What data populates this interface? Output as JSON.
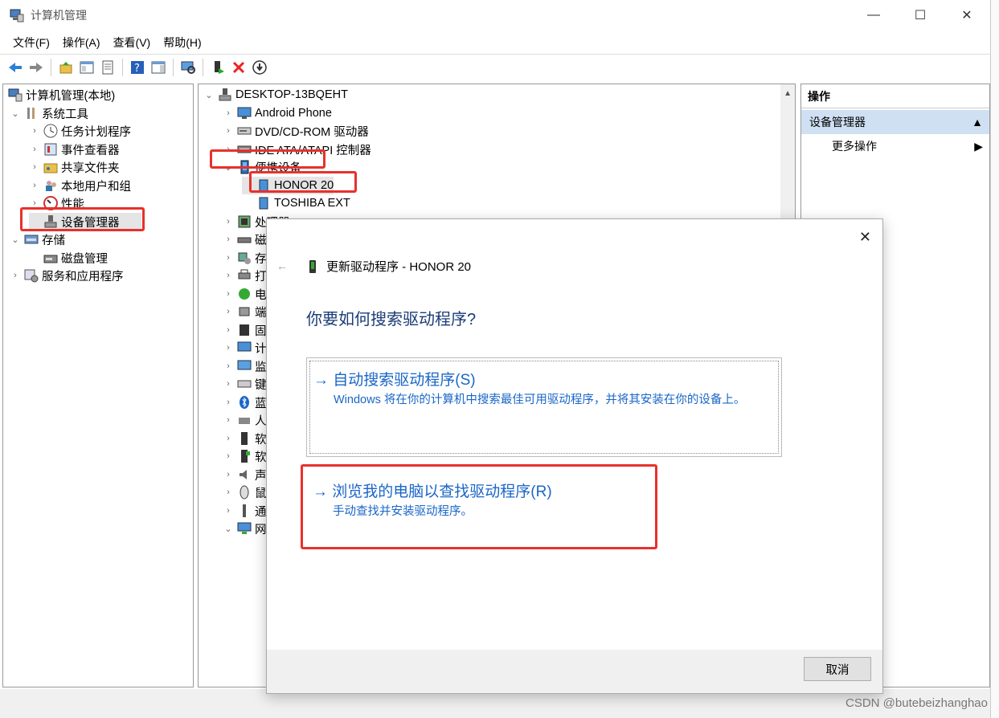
{
  "window": {
    "title": "计算机管理",
    "minimize": "—",
    "maximize": "☐",
    "close": "✕"
  },
  "menu": [
    "文件(F)",
    "操作(A)",
    "查看(V)",
    "帮助(H)"
  ],
  "left_tree": {
    "root": "计算机管理(本地)",
    "system_tools": "系统工具",
    "task_scheduler": "任务计划程序",
    "event_viewer": "事件查看器",
    "shared_folders": "共享文件夹",
    "local_users": "本地用户和组",
    "performance": "性能",
    "device_manager": "设备管理器",
    "storage": "存储",
    "disk_management": "磁盘管理",
    "services_apps": "服务和应用程序"
  },
  "device_tree": {
    "computer": "DESKTOP-13BQEHT",
    "android_phone": "Android Phone",
    "dvd": "DVD/CD-ROM 驱动器",
    "ide": "IDE ATA/ATAPI 控制器",
    "portable": "便携设备",
    "honor": "HONOR 20",
    "toshiba": "TOSHIBA EXT",
    "processor": "处理器",
    "partial": [
      "磁",
      "存",
      "打",
      "电",
      "端",
      "固",
      "计",
      "监",
      "键",
      "蓝",
      "人",
      "软",
      "软",
      "声",
      "鼠",
      "通",
      "网"
    ]
  },
  "ops": {
    "header": "操作",
    "group": "设备管理器",
    "more": "更多操作"
  },
  "dialog": {
    "title": "更新驱动程序 - HONOR 20",
    "heading": "你要如何搜索驱动程序?",
    "option1_title": "自动搜索驱动程序(S)",
    "option1_desc": "Windows 将在你的计算机中搜索最佳可用驱动程序，并将其安装在你的设备上。",
    "option2_title": "浏览我的电脑以查找驱动程序(R)",
    "option2_desc": "手动查找并安装驱动程序。",
    "cancel": "取消",
    "close": "✕",
    "back": "←"
  },
  "watermark": "CSDN @butebeizhanghao",
  "colors": {
    "accent_blue": "#1a66c7",
    "heading_blue": "#1a3b78",
    "highlight_red": "#e8312c",
    "ops_group_bg": "#cfe0f3"
  }
}
